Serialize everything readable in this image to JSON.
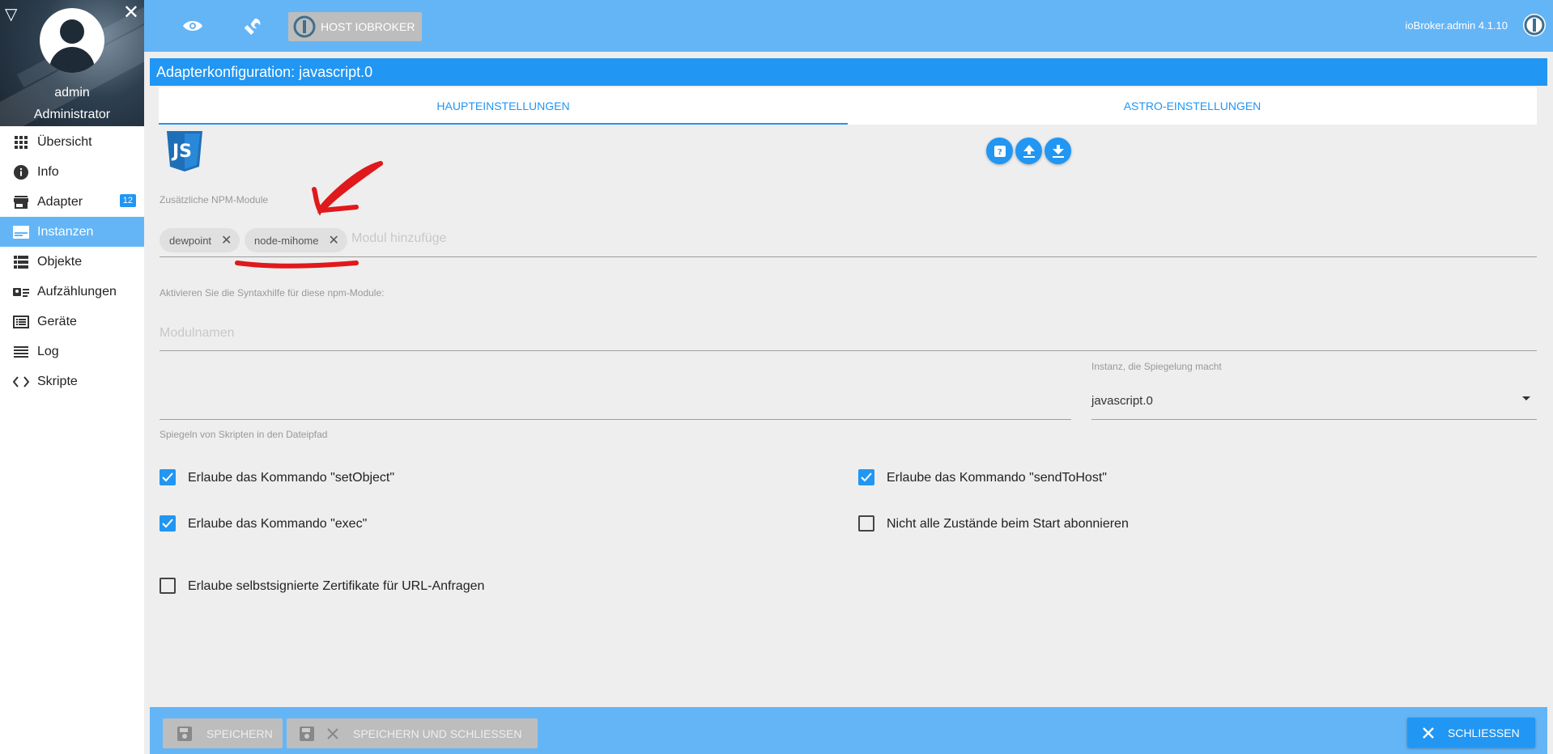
{
  "sidebar": {
    "user_name": "admin",
    "user_role": "Administrator",
    "items": [
      {
        "label": "Übersicht",
        "icon": "grid-icon"
      },
      {
        "label": "Info",
        "icon": "info-icon"
      },
      {
        "label": "Adapter",
        "icon": "store-icon",
        "badge": "12"
      },
      {
        "label": "Instanzen",
        "icon": "instances-icon",
        "active": true
      },
      {
        "label": "Objekte",
        "icon": "list-icon"
      },
      {
        "label": "Aufzählungen",
        "icon": "enum-icon"
      },
      {
        "label": "Geräte",
        "icon": "devices-icon"
      },
      {
        "label": "Log",
        "icon": "log-icon"
      },
      {
        "label": "Skripte",
        "icon": "code-icon"
      }
    ]
  },
  "topbar": {
    "host_button": "HOST IOBROKER",
    "version": "ioBroker.admin 4.1.10"
  },
  "config": {
    "title": "Adapterkonfiguration: javascript.0",
    "tabs": [
      "HAUPTEINSTELLUNGEN",
      "ASTRO-EINSTELLUNGEN"
    ],
    "npm_label": "Zusätzliche NPM-Module",
    "chips": [
      "dewpoint",
      "node-mihome"
    ],
    "npm_placeholder": "Modul hinzufüge",
    "syntax_label": "Aktivieren Sie die Syntaxhilfe für diese npm-Module:",
    "syntax_placeholder": "Modulnamen",
    "mirror_path_label": "Spiegeln von Skripten in den Dateipfad",
    "mirror_instance_label": "Instanz, die Spiegelung macht",
    "mirror_instance_value": "javascript.0",
    "checkboxes": [
      {
        "label": "Erlaube das Kommando \"setObject\"",
        "checked": true
      },
      {
        "label": "Erlaube das Kommando \"sendToHost\"",
        "checked": true
      },
      {
        "label": "Erlaube das Kommando \"exec\"",
        "checked": true
      },
      {
        "label": "Nicht alle Zustände beim Start abonnieren",
        "checked": false
      },
      {
        "label": "Erlaube selbstsignierte Zertifikate für URL-Anfragen",
        "checked": false
      }
    ]
  },
  "bottombar": {
    "save": "SPEICHERN",
    "save_close": "SPEICHERN UND SCHLIESSEN",
    "close": "SCHLIESSEN"
  },
  "colors": {
    "primary": "#2196f3",
    "topbar": "#64b5f6",
    "annotation": "#e0191c"
  }
}
